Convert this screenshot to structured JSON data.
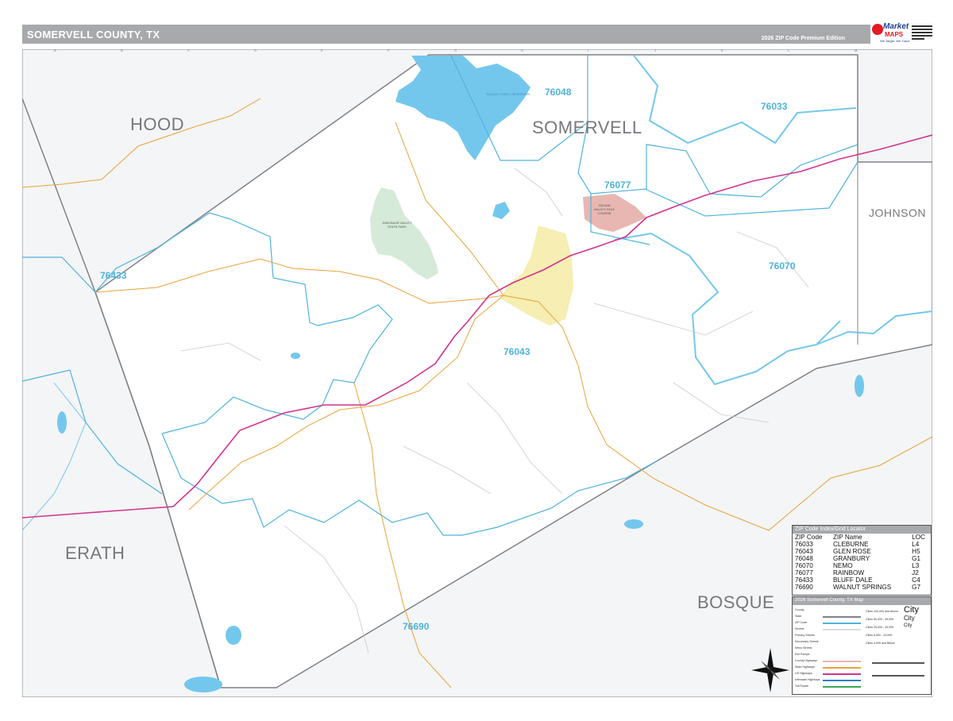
{
  "header": {
    "title": "SOMERVELL COUNTY, TX",
    "edition": "2026 ZIP Code Premium Edition"
  },
  "brand": {
    "name_top": "Market",
    "name_bottom": "MAPS",
    "tagline": "We Target. We Trace."
  },
  "map": {
    "counties": [
      "HOOD",
      "SOMERVELL",
      "JOHNSON",
      "ERATH",
      "BOSQUE"
    ],
    "zips": [
      "76048",
      "76033",
      "76077",
      "76070",
      "76433",
      "76043",
      "76690"
    ],
    "features": {
      "reservoir": "SQUAW CREEK RESERVOIR",
      "park": "DINOSAUR VALLEY STATE PARK",
      "golf": "SQUAW VALLEY GOLF COURSE"
    },
    "colors": {
      "water": "#74c7ec",
      "zip_boundary": "#4fb3de",
      "county_outline": "#808285",
      "us_highway": "#d2338f",
      "state_highway": "#e8a33c",
      "park": "#d5ead9",
      "city": "#f6eeb2",
      "golf": "#e8b7b1",
      "outside_county": "#f4f5f6"
    }
  },
  "zip_index": {
    "heading": "ZIP Code Index/Grid Locator",
    "columns": [
      "ZIP Code",
      "ZIP Name",
      "LOC"
    ],
    "rows": [
      [
        "76033",
        "CLEBURNE",
        "L4"
      ],
      [
        "76043",
        "GLEN ROSE",
        "H5"
      ],
      [
        "76048",
        "GRANBURY",
        "G1"
      ],
      [
        "76070",
        "NEMO",
        "L3"
      ],
      [
        "76077",
        "RAINBOW",
        "J2"
      ],
      [
        "76433",
        "BLUFF DALE",
        "C4"
      ],
      [
        "76690",
        "WALNUT SPRINGS",
        "G7"
      ]
    ]
  },
  "legend": {
    "heading": "2026 Somervell County, TX Map",
    "items": [
      "County",
      "State",
      "ZIP Code",
      "Streets",
      "Primary Streets",
      "Secondary Streets",
      "Minor Streets",
      "Exit Ramps",
      "County Highways",
      "State Highways",
      "US Highways",
      "Interstate Highways",
      "Toll Roads"
    ],
    "city_sizes": [
      "Cities 100,000 and Above",
      "Cities 50,000 - 99,999",
      "Cities 25,000 - 49,999",
      "Cities 5,000 - 24,999",
      "Cities 4,999 and Below"
    ],
    "city_symbols": [
      "City",
      "City",
      "City"
    ]
  },
  "grid": {
    "columns": [
      "A",
      "B",
      "C",
      "D",
      "E",
      "F",
      "G",
      "H",
      "I",
      "J",
      "K",
      "L",
      "M"
    ]
  }
}
